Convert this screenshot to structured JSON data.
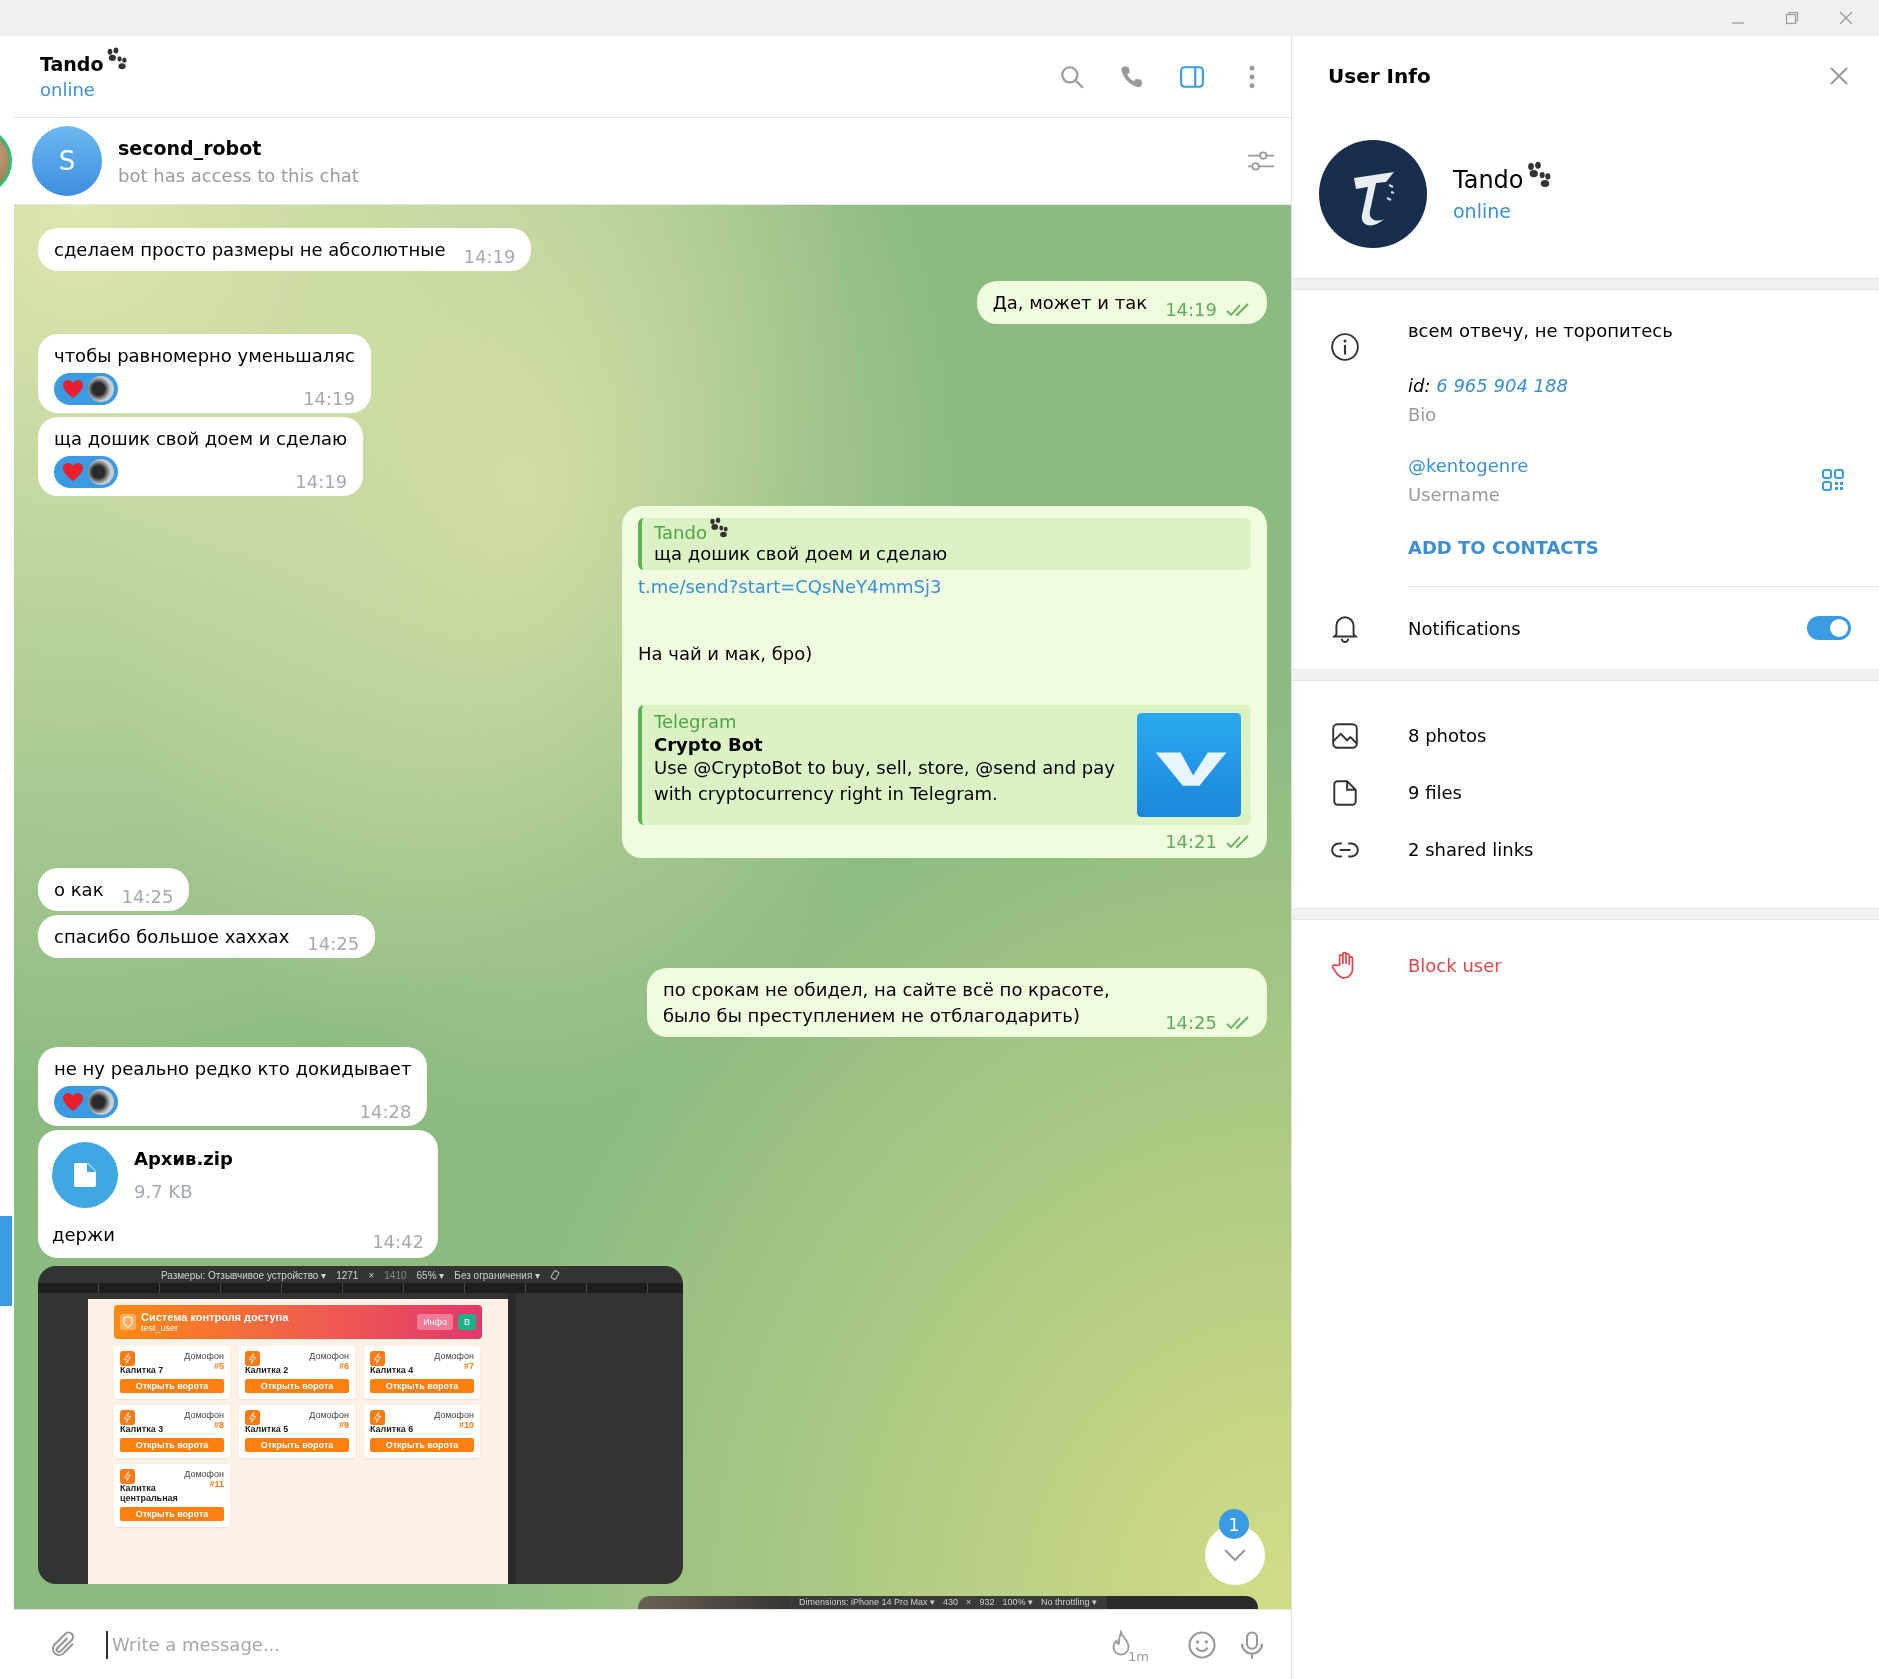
{
  "chat_header": {
    "title": "Tando",
    "status": "online",
    "icons": [
      {
        "kind": "search",
        "active": false
      },
      {
        "kind": "call",
        "active": false
      },
      {
        "kind": "panel",
        "active": true
      },
      {
        "kind": "more",
        "active": false
      }
    ]
  },
  "pinned": {
    "avatar_letter": "S",
    "title": "second_robot",
    "subtitle": "bot has access to this chat"
  },
  "messages": [
    {
      "kind": "text",
      "outgoing": false,
      "text": "сделаем просто размеры не абсолютные",
      "time": "14:19",
      "reaction": false
    },
    {
      "kind": "text",
      "outgoing": true,
      "text": "Да, может и так",
      "time": "14:19",
      "reaction": false,
      "read": true
    },
    {
      "kind": "text",
      "outgoing": false,
      "text": "чтобы равномерно уменьшаляс",
      "time": "14:19",
      "reaction": true
    },
    {
      "kind": "text",
      "outgoing": false,
      "text": "ща дошик свой доем и сделаю",
      "time": "14:19",
      "reaction": true
    },
    {
      "kind": "reply_link",
      "outgoing": true,
      "reply": {
        "author": "Tando",
        "text": "ща дошик свой доем и сделаю"
      },
      "link": "t.me/send?start=CQsNeY4mmSj3",
      "text": "На чай и мак, бро)",
      "preview": {
        "site": "Telegram",
        "title": "Crypto Bot",
        "description": "Use @CryptoBot to buy, sell, store, @send and pay with cryptocurrency right in Telegram."
      },
      "time": "14:21",
      "read": true
    },
    {
      "kind": "text",
      "outgoing": false,
      "text": "о как",
      "time": "14:25",
      "reaction": false
    },
    {
      "kind": "text",
      "outgoing": false,
      "text": "спасибо большое хаххах",
      "time": "14:25",
      "reaction": false
    },
    {
      "kind": "text",
      "outgoing": true,
      "text": "по срокам не обидел, на сайте всё по красоте, было бы преступлением не отблагодарить)",
      "time": "14:25",
      "reaction": false,
      "read": true
    },
    {
      "kind": "text",
      "outgoing": false,
      "text": "не ну реально редко кто докидывает",
      "time": "14:28",
      "reaction": true
    },
    {
      "kind": "file",
      "outgoing": false,
      "file_name": "Архив.zip",
      "size": "9.7 KB",
      "caption": "держи",
      "time": "14:42"
    },
    {
      "kind": "screenshot",
      "outgoing": false,
      "toolbar": [
        {
          "text": "Размеры: Отзывчивое устройство ▾",
          "disabled": false
        },
        {
          "text": "1271",
          "disabled": false
        },
        {
          "text": "×",
          "disabled": false
        },
        {
          "text": "1410",
          "disabled": true
        },
        {
          "text": "65% ▾",
          "disabled": false
        },
        {
          "text": "Без ограничения ▾",
          "disabled": false
        }
      ],
      "header": {
        "title": "Система контроля доступа",
        "subtitle": "test_user",
        "buttons": [
          "Инфо",
          "В"
        ]
      },
      "cards": [
        {
          "name": "Калитка 7",
          "label": "Домофон",
          "number": "#5",
          "button": "Открыть ворота"
        },
        {
          "name": "Калитка 2",
          "label": "Домофон",
          "number": "#6",
          "button": "Открыть ворота"
        },
        {
          "name": "Калитка 4",
          "label": "Домофон",
          "number": "#7",
          "button": "Открыть ворота"
        },
        {
          "name": "Калитка 3",
          "label": "Домофон",
          "number": "#8",
          "button": "Открыть ворота"
        },
        {
          "name": "Калитка 5",
          "label": "Домофон",
          "number": "#9",
          "button": "Открыть ворота"
        },
        {
          "name": "Калитка 6",
          "label": "Домофон",
          "number": "#10",
          "button": "Открыть ворота"
        },
        {
          "name": "Калитка центральная",
          "label": "Домофон",
          "number": "#11",
          "button": "Открыть ворота"
        }
      ]
    },
    {
      "kind": "screenshot_cut",
      "outgoing": true,
      "toolbar": [
        "Dimensions: iPhone 14 Pro Max ▾",
        "430",
        "×",
        "932",
        "100% ▾",
        "No throttling ▾"
      ]
    }
  ],
  "scroll_badge": "1",
  "composer": {
    "placeholder": "Write a message...",
    "timer": "1m"
  },
  "user_info": {
    "title": "User Info",
    "name": "Tando",
    "status": "online",
    "bio": "всем отвечу, не торопитесь",
    "id_label": "id:",
    "id": "6 965 904 188",
    "bio_label": "Bio",
    "username": "@kentogenre",
    "username_label": "Username",
    "add_contacts": "ADD TO CONTACTS",
    "notifications": {
      "label": "Notifications",
      "on": true
    },
    "media": [
      {
        "kind": "photos",
        "label": "8 photos"
      },
      {
        "kind": "files",
        "label": "9 files"
      },
      {
        "kind": "links",
        "label": "2 shared links"
      }
    ],
    "block": "Block user"
  }
}
